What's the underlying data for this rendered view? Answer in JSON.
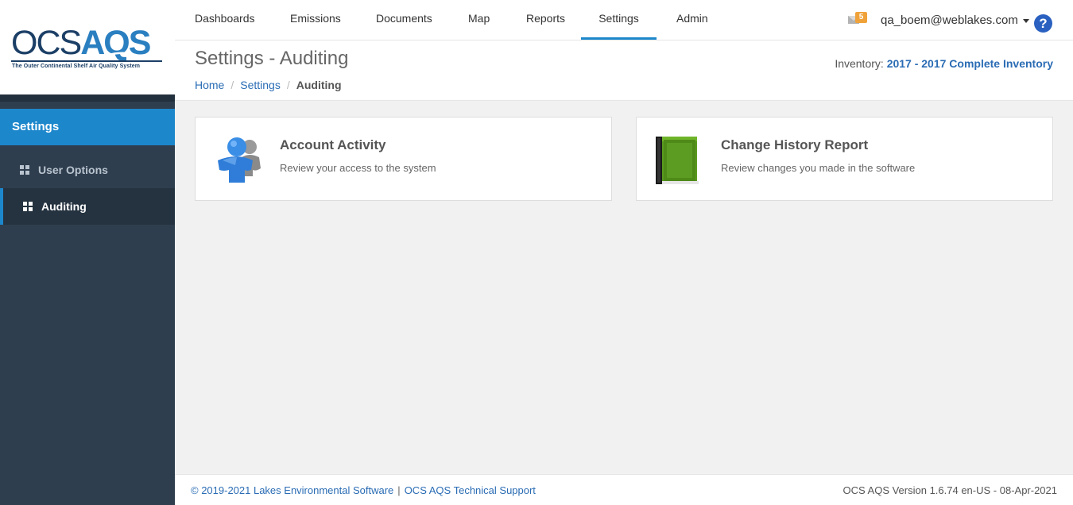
{
  "logo": {
    "ocs": "OCS",
    "aqs": "AQS",
    "tagline": "The Outer Continental Shelf Air Quality System"
  },
  "sidebar": {
    "title": "Settings",
    "items": [
      {
        "label": "User Options",
        "icon": "grid-icon",
        "active": false
      },
      {
        "label": "Auditing",
        "icon": "grid-icon",
        "active": true
      }
    ]
  },
  "nav": {
    "items": [
      {
        "label": "Dashboards"
      },
      {
        "label": "Emissions"
      },
      {
        "label": "Documents"
      },
      {
        "label": "Map"
      },
      {
        "label": "Reports"
      },
      {
        "label": "Settings",
        "active": true
      },
      {
        "label": "Admin"
      }
    ],
    "mail_count": "5",
    "user": "qa_boem@weblakes.com",
    "help": "?"
  },
  "header": {
    "title": "Settings - Auditing",
    "breadcrumb": [
      "Home",
      "Settings",
      "Auditing"
    ],
    "inventory_label": "Inventory:",
    "inventory_value": "2017 - 2017 Complete Inventory"
  },
  "cards": [
    {
      "title": "Account Activity",
      "description": "Review your access to the system",
      "icon": "user-icon"
    },
    {
      "title": "Change History Report",
      "description": "Review changes you made in the software",
      "icon": "book-icon"
    }
  ],
  "footer": {
    "copyright": "© 2019-2021 Lakes Environmental Software",
    "separator": "|",
    "support": "OCS AQS Technical Support",
    "version": "OCS AQS Version 1.6.74 en-US - 08-Apr-2021"
  },
  "colors": {
    "accent": "#1d87cc",
    "sidebar": "#2f3e4e",
    "link": "#2a6cb4",
    "badge": "#f0a23a"
  }
}
